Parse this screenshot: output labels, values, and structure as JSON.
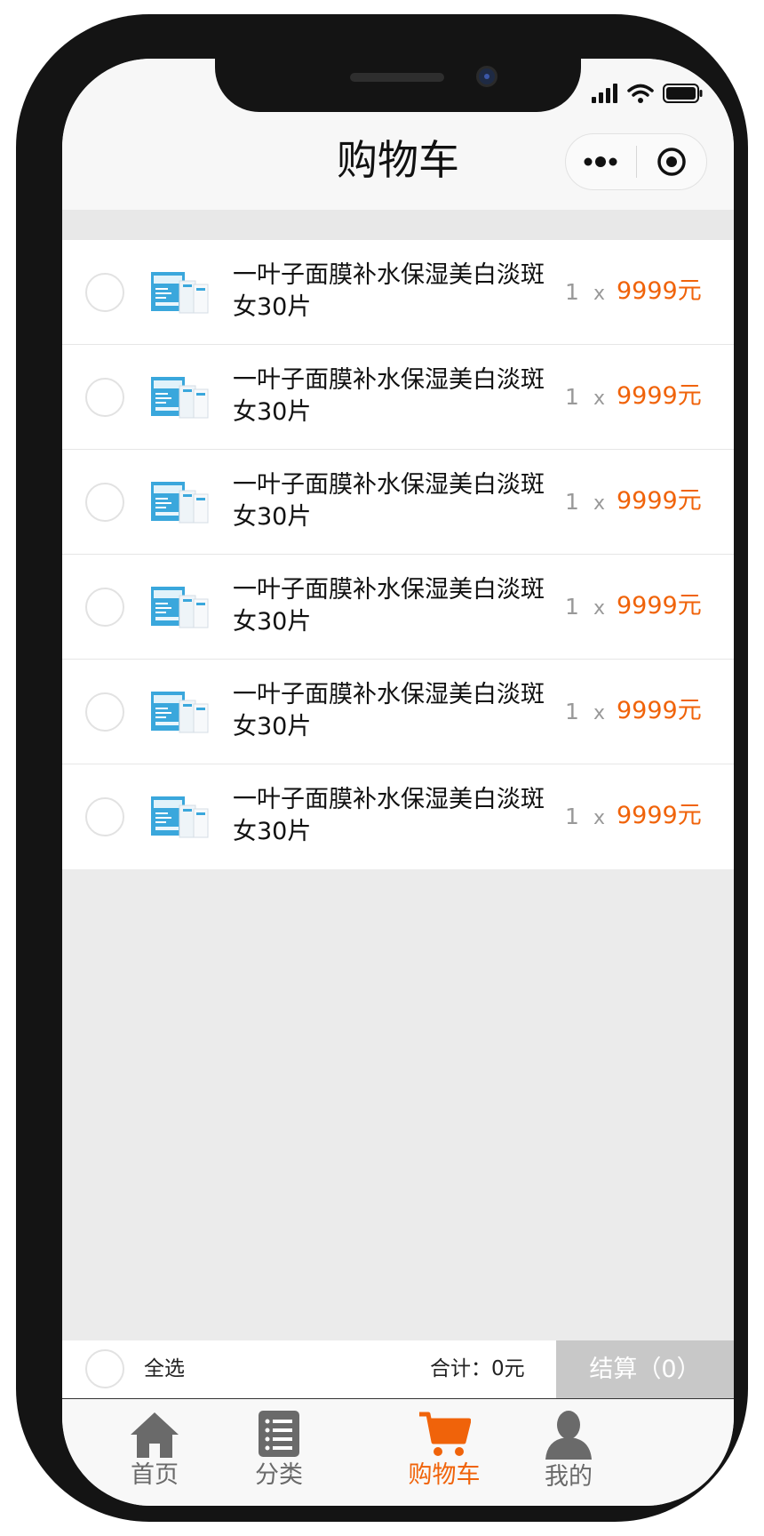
{
  "header": {
    "title": "购物车",
    "capsule_more_icon": "more-dots-icon",
    "capsule_close_icon": "target-circle-icon"
  },
  "status_bar": {
    "icons": [
      "signal-icon",
      "wifi-icon",
      "battery-icon"
    ]
  },
  "cart": {
    "items": [
      {
        "name": "一叶子面膜补水保湿美白淡斑女30片",
        "qty": "1",
        "x": "x",
        "price": "9999元"
      },
      {
        "name": "一叶子面膜补水保湿美白淡斑女30片",
        "qty": "1",
        "x": "x",
        "price": "9999元"
      },
      {
        "name": "一叶子面膜补水保湿美白淡斑女30片",
        "qty": "1",
        "x": "x",
        "price": "9999元"
      },
      {
        "name": "一叶子面膜补水保湿美白淡斑女30片",
        "qty": "1",
        "x": "x",
        "price": "9999元"
      },
      {
        "name": "一叶子面膜补水保湿美白淡斑女30片",
        "qty": "1",
        "x": "x",
        "price": "9999元"
      },
      {
        "name": "一叶子面膜补水保湿美白淡斑女30片",
        "qty": "1",
        "x": "x",
        "price": "9999元"
      }
    ]
  },
  "checkout": {
    "select_all": "全选",
    "total": "合计：0元",
    "button": "结算（0）"
  },
  "tabbar": {
    "tabs": [
      {
        "label": "首页",
        "icon": "home-icon"
      },
      {
        "label": "分类",
        "icon": "list-icon"
      },
      {
        "label": "购物车",
        "icon": "cart-icon",
        "active": true
      },
      {
        "label": "我的",
        "icon": "user-icon"
      }
    ]
  },
  "colors": {
    "accent": "#f0630a",
    "price": "#f0630a",
    "checkout_button_bg": "#c8c8c8",
    "thumb_blue": "#3aa7dc"
  }
}
